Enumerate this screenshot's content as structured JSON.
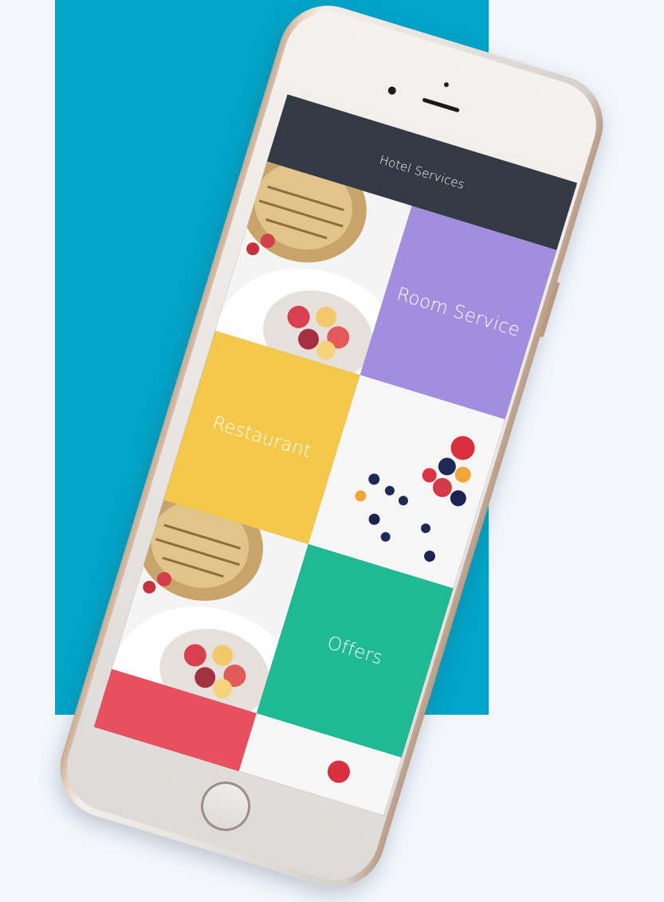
{
  "screen": {
    "header": {
      "title": "Hotel Services"
    },
    "tiles": [
      {
        "label": "",
        "kind": "photo",
        "icon": "fruit-bowl-photo"
      },
      {
        "label": "Room Service",
        "kind": "service",
        "color": "#a38ddf"
      },
      {
        "label": "Restaurant",
        "kind": "service",
        "color": "#f4c94b"
      },
      {
        "label": "",
        "kind": "photo",
        "icon": "berries-photo"
      },
      {
        "label": "",
        "kind": "photo",
        "icon": "fruit-bowl-photo"
      },
      {
        "label": "Offers",
        "kind": "service",
        "color": "#1fb994"
      },
      {
        "label": "",
        "kind": "service",
        "color": "#e9505f"
      },
      {
        "label": "",
        "kind": "photo",
        "icon": "berries-photo"
      }
    ]
  },
  "colors": {
    "backdrop": "#00a5c8",
    "header": "#333a44",
    "page": "#f3f7fd"
  }
}
